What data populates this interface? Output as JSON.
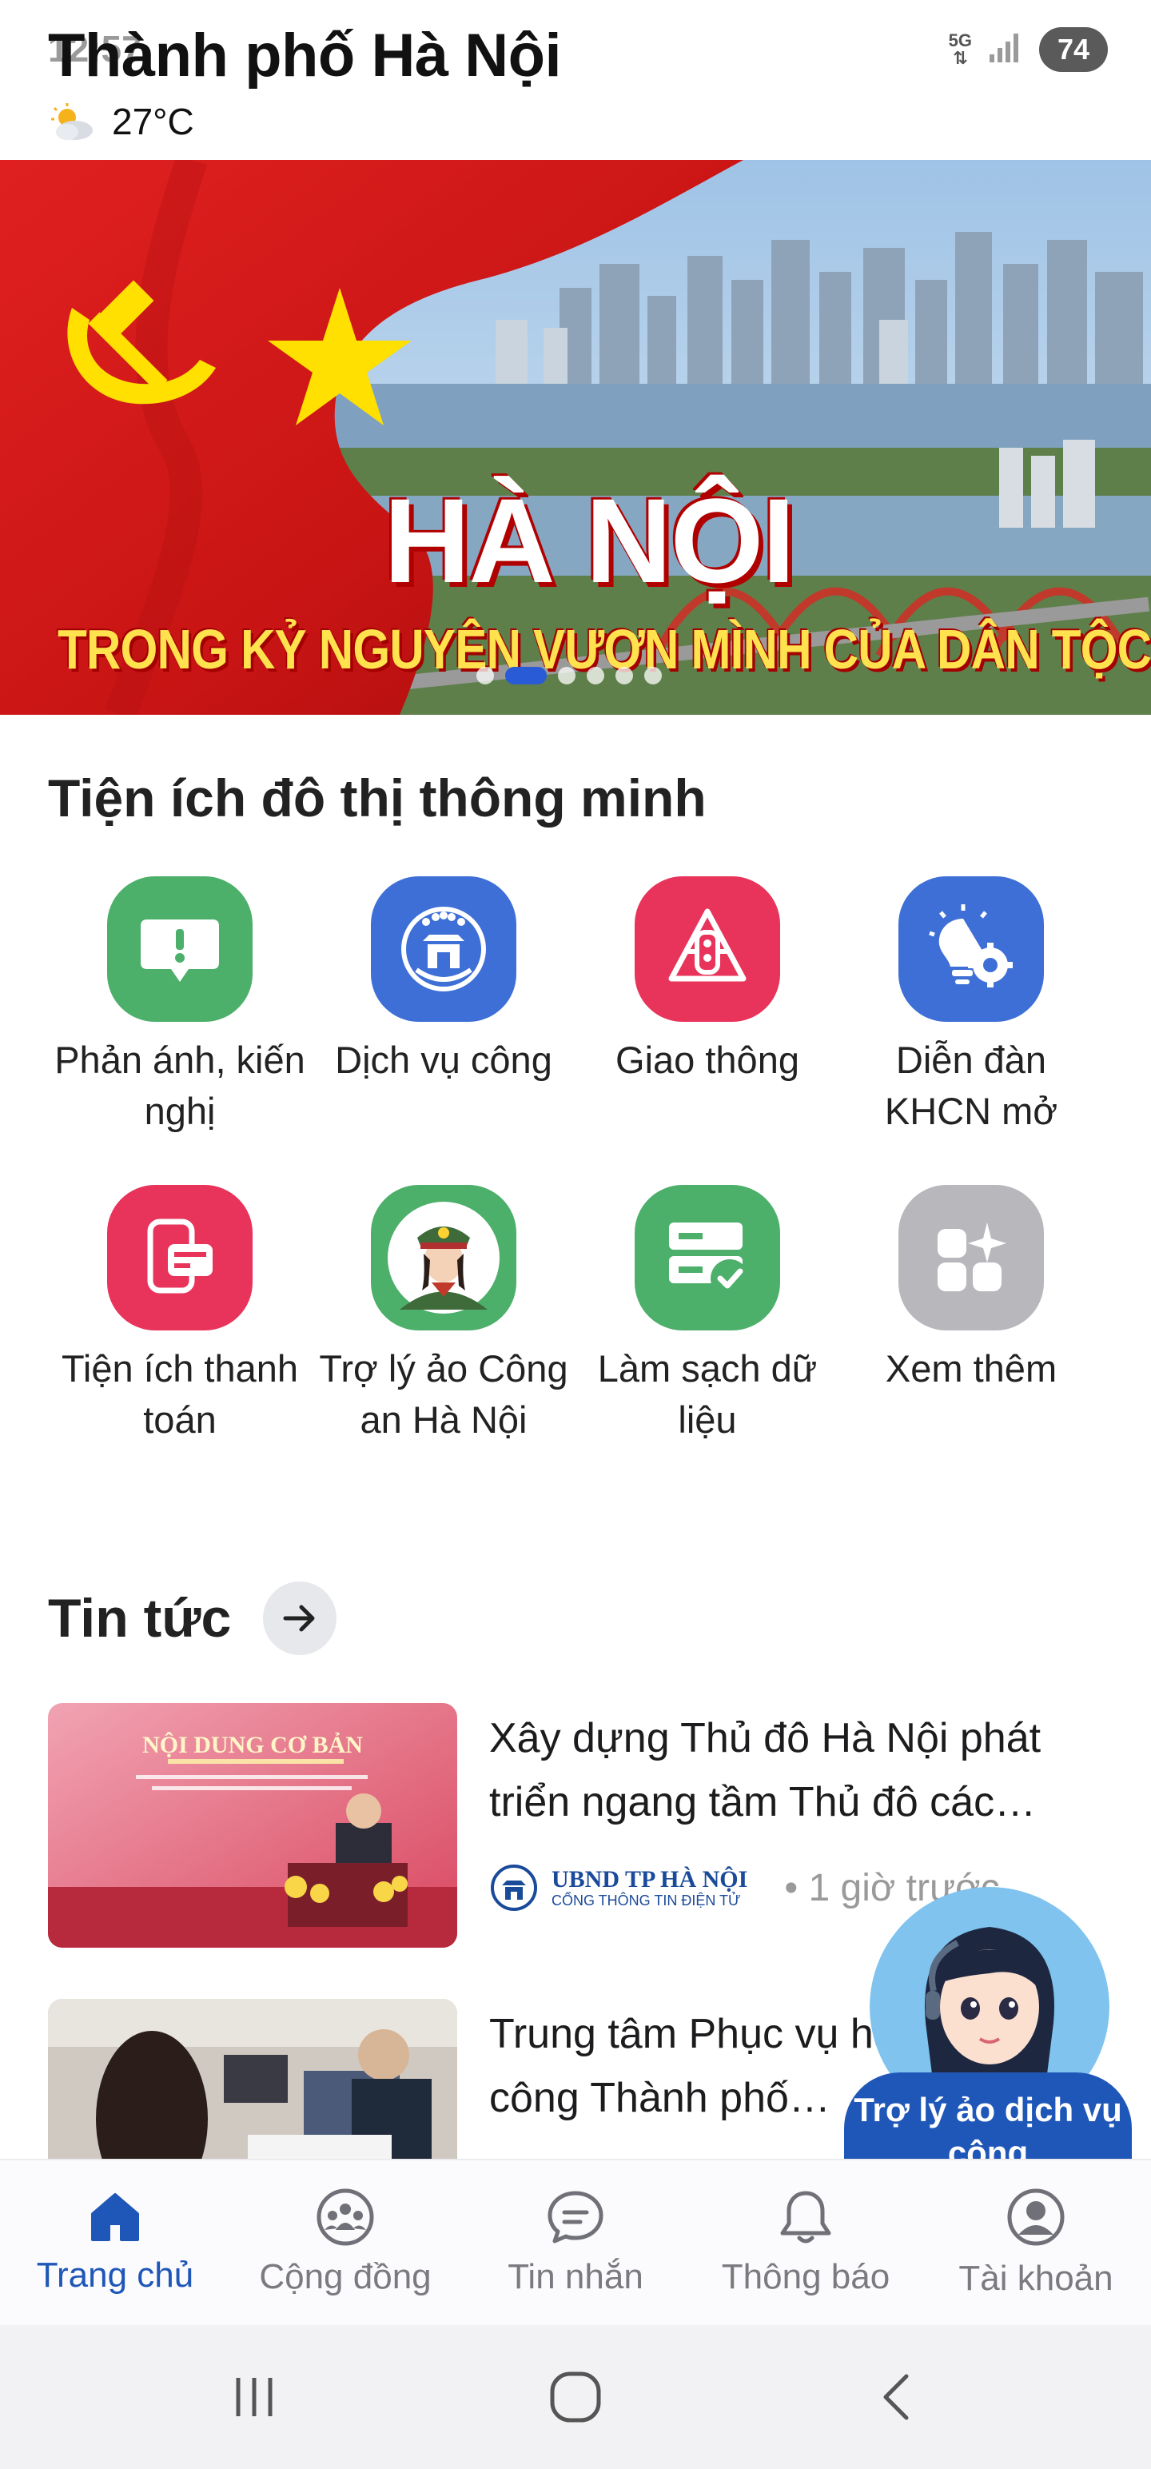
{
  "status": {
    "time": "12:57",
    "network": "5G",
    "battery": "74"
  },
  "header": {
    "city": "Thành phố Hà Nội",
    "temperature": "27°C",
    "weather_icon": "partly-cloudy-icon"
  },
  "banner": {
    "title": "HÀ NỘI",
    "subtitle": "TRONG KỶ NGUYÊN VƯƠN MÌNH CỦA DÂN TỘC",
    "slide_count": 6,
    "active_slide": 2
  },
  "utilities": {
    "title": "Tiện ích đô thị thông minh",
    "items": [
      {
        "label": "Phản ánh, kiến nghị",
        "icon": "feedback-icon",
        "color": "#4caf6a"
      },
      {
        "label": "Dịch vụ công",
        "icon": "public-service-emblem-icon",
        "color": "#3d6fd6"
      },
      {
        "label": "Giao thông",
        "icon": "traffic-light-icon",
        "color": "#e8335a"
      },
      {
        "label": "Diễn đàn KHCN mở",
        "icon": "lightbulb-gear-icon",
        "color": "#3d6fd6"
      },
      {
        "label": "Tiện ích thanh toán",
        "icon": "payment-card-icon",
        "color": "#e8335a"
      },
      {
        "label": "Trợ lý ảo Công an Hà Nội",
        "icon": "police-assistant-icon",
        "color": "#4caf6a"
      },
      {
        "label": "Làm sạch dữ liệu",
        "icon": "data-clean-icon",
        "color": "#4caf6a"
      },
      {
        "label": "Xem thêm",
        "icon": "more-apps-icon",
        "color": "#b8b8bc"
      }
    ]
  },
  "news": {
    "title": "Tin tức",
    "items": [
      {
        "title": "Xây dựng Thủ đô Hà Nội phát triển ngang tầm Thủ đô các…",
        "source": "UBND TP HÀ NỘI",
        "source_sub": "CỔNG THÔNG TIN ĐIỆN TỬ",
        "time": "1 giờ trước",
        "thumb_heading": "NỘI DUNG CƠ BẢN"
      },
      {
        "title": "Trung tâm Phục vụ hành chính công Thành phố…"
      }
    ]
  },
  "assistant": {
    "label": "Trợ lý ảo dịch vụ công"
  },
  "nav": {
    "items": [
      {
        "label": "Trang chủ",
        "icon": "home-icon",
        "active": true
      },
      {
        "label": "Cộng đồng",
        "icon": "community-icon"
      },
      {
        "label": "Tin nhắn",
        "icon": "message-icon"
      },
      {
        "label": "Thông báo",
        "icon": "bell-icon"
      },
      {
        "label": "Tài khoản",
        "icon": "account-icon"
      }
    ]
  },
  "system_nav": {
    "recent": "recent-apps-icon",
    "home": "home-circle-icon",
    "back": "back-icon"
  },
  "colors": {
    "accent": "#1f57b8",
    "banner_red": "#d71d1d",
    "star_yellow": "#ffe000"
  }
}
